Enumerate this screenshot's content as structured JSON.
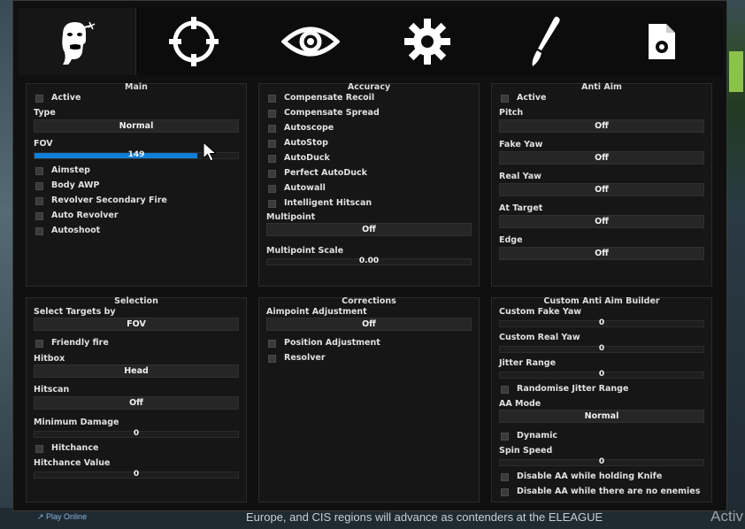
{
  "tabs": [
    {
      "icon": "head-target-icon",
      "active": true
    },
    {
      "icon": "crosshair-icon",
      "active": false
    },
    {
      "icon": "eye-icon",
      "active": false
    },
    {
      "icon": "gear-icon",
      "active": false
    },
    {
      "icon": "paintbrush-icon",
      "active": false
    },
    {
      "icon": "config-file-icon",
      "active": false
    }
  ],
  "main": {
    "title": "Main",
    "active": "Active",
    "type_label": "Type",
    "type_value": "Normal",
    "fov_label": "FOV",
    "fov_value": "149",
    "fov_fill": 0.8,
    "aimstep": "Aimstep",
    "body_awp": "Body AWP",
    "revolver_secondary": "Revolver Secondary Fire",
    "auto_revolver": "Auto Revolver",
    "autoshoot": "Autoshoot"
  },
  "accuracy": {
    "title": "Accuracy",
    "compensate_recoil": "Compensate Recoil",
    "compensate_spread": "Compensate Spread",
    "autoscope": "Autoscope",
    "autostop": "AutoStop",
    "autoduck": "AutoDuck",
    "perfect_autoduck": "Perfect AutoDuck",
    "autowall": "Autowall",
    "intelligent_hitscan": "Intelligent Hitscan",
    "multipoint_label": "Multipoint",
    "multipoint_value": "Off",
    "multipoint_scale_label": "Multipoint Scale",
    "multipoint_scale_value": "0.00"
  },
  "antiaim": {
    "title": "Anti Aim",
    "active": "Active",
    "pitch_label": "Pitch",
    "pitch_value": "Off",
    "fake_yaw_label": "Fake Yaw",
    "fake_yaw_value": "Off",
    "real_yaw_label": "Real Yaw",
    "real_yaw_value": "Off",
    "at_target_label": "At Target",
    "at_target_value": "Off",
    "edge_label": "Edge",
    "edge_value": "Off"
  },
  "selection": {
    "title": "Selection",
    "select_targets_label": "Select Targets by",
    "select_targets_value": "FOV",
    "friendly_fire": "Friendly fire",
    "hitbox_label": "Hitbox",
    "hitbox_value": "Head",
    "hitscan_label": "Hitscan",
    "hitscan_value": "Off",
    "min_damage_label": "Minimum Damage",
    "min_damage_value": "0",
    "hitchance": "Hitchance",
    "hitchance_value_label": "Hitchance Value",
    "hitchance_value": "0"
  },
  "corrections": {
    "title": "Corrections",
    "aimpoint_label": "Aimpoint Adjustment",
    "aimpoint_value": "Off",
    "position_adjustment": "Position Adjustment",
    "resolver": "Resolver"
  },
  "builder": {
    "title": "Custom Anti Aim Builder",
    "custom_fake_yaw_label": "Custom Fake Yaw",
    "custom_fake_yaw_value": "0",
    "custom_real_yaw_label": "Custom Real Yaw",
    "custom_real_yaw_value": "0",
    "jitter_range_label": "Jitter Range",
    "jitter_range_value": "0",
    "randomise_jitter": "Randomise Jitter Range",
    "aa_mode_label": "AA Mode",
    "aa_mode_value": "Normal",
    "dynamic": "Dynamic",
    "spin_speed_label": "Spin Speed",
    "spin_speed_value": "0",
    "disable_knife": "Disable AA while holding Knife",
    "disable_no_enemies": "Disable AA while there are no enemies"
  },
  "background": {
    "play_online": "Play Online",
    "news_text": "Europe, and CIS regions will advance as contenders at the ELEAGUE",
    "activate_text": "Activ"
  }
}
